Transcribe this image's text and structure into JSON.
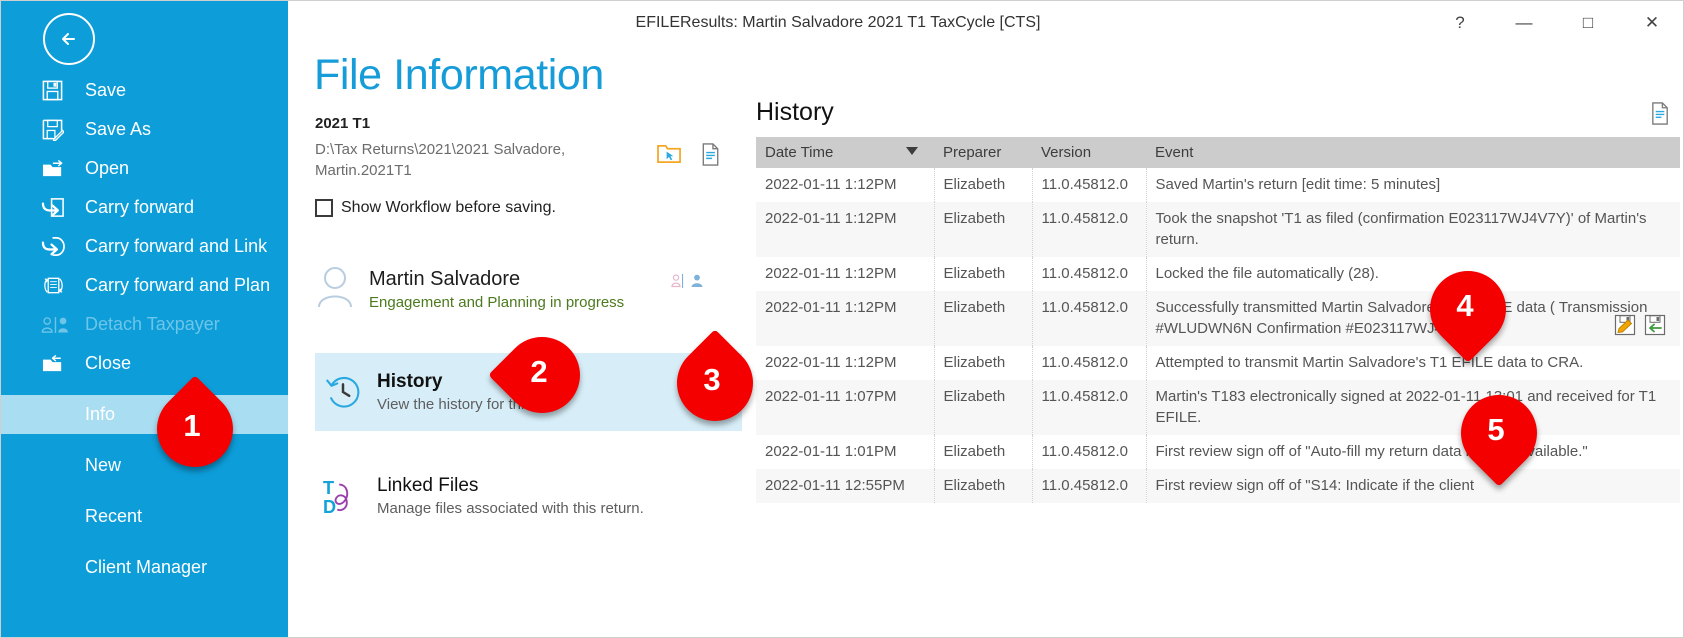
{
  "window": {
    "title": "EFILEResults: Martin Salvadore 2021 T1 TaxCycle [CTS]",
    "help_glyph": "?",
    "minimize_glyph": "—",
    "maximize_glyph": "□",
    "close_glyph": "✕"
  },
  "sidebar": {
    "back_label": "Back",
    "items": [
      {
        "label": "Save",
        "icon": "save-icon",
        "state": "normal"
      },
      {
        "label": "Save As",
        "icon": "save-as-icon",
        "state": "normal"
      },
      {
        "label": "Open",
        "icon": "open-folder-icon",
        "state": "normal"
      },
      {
        "label": "Carry forward",
        "icon": "carry-forward-icon",
        "state": "normal"
      },
      {
        "label": "Carry forward and Link",
        "icon": "carry-forward-link-icon",
        "state": "normal"
      },
      {
        "label": "Carry forward and Plan",
        "icon": "carry-forward-plan-icon",
        "state": "normal"
      },
      {
        "label": "Detach Taxpayer",
        "icon": "detach-taxpayer-icon",
        "state": "disabled"
      },
      {
        "label": "Close",
        "icon": "close-folder-icon",
        "state": "normal"
      },
      {
        "label": "Info",
        "icon": "",
        "state": "selected"
      },
      {
        "label": "New",
        "icon": "",
        "state": "normal"
      },
      {
        "label": "Recent",
        "icon": "",
        "state": "normal"
      },
      {
        "label": "Client Manager",
        "icon": "",
        "state": "normal"
      }
    ]
  },
  "main": {
    "page_title": "File Information",
    "form_year": "2021 T1",
    "file_path": "D:\\Tax Returns\\2021\\2021 Salvadore, Martin.2021T1",
    "path_icons": [
      {
        "name": "open-containing-folder-icon"
      },
      {
        "name": "file-properties-icon"
      }
    ],
    "checkbox": {
      "label": "Show Workflow before saving.",
      "checked": false
    },
    "taxpayer": {
      "name": "Martin Salvadore",
      "status": "Engagement and Planning in progress",
      "avatar_icon": "person-avatar-icon",
      "badges": [
        "couple-link-icon",
        "person-icon"
      ]
    },
    "cards": [
      {
        "title": "History",
        "subtitle": "View the history for this file.",
        "icon": "history-clock-icon",
        "selected": true
      },
      {
        "title": "Linked Files",
        "subtitle": "Manage files associated with this return.",
        "icon": "linked-files-icon",
        "selected": false
      }
    ]
  },
  "history": {
    "heading": "History",
    "export_icon": "export-document-icon",
    "columns": [
      "Date Time",
      "Preparer",
      "Version",
      "Event"
    ],
    "sorted_column": "Date Time",
    "sort_direction": "descending",
    "rows": [
      {
        "datetime": "2022-01-11 1:12PM",
        "preparer": "Elizabeth",
        "version": "11.0.45812.0",
        "event": "Saved Martin's return [edit time: 5 minutes]",
        "actions": []
      },
      {
        "datetime": "2022-01-11 1:12PM",
        "preparer": "Elizabeth",
        "version": "11.0.45812.0",
        "event": "Took the snapshot 'T1 as filed (confirmation E023117WJ4V7Y)' of Martin's return.",
        "actions": []
      },
      {
        "datetime": "2022-01-11 1:12PM",
        "preparer": "Elizabeth",
        "version": "11.0.45812.0",
        "event": "Locked the file automatically (28).",
        "actions": []
      },
      {
        "datetime": "2022-01-11 1:12PM",
        "preparer": "Elizabeth",
        "version": "11.0.45812.0",
        "event": "Successfully transmitted Martin Salvadore's T1 EFILE data  ( Transmission #WLUDWN6N Confirmation #E023117WJ4V7Y ).",
        "actions": [
          "open-snapshot-icon",
          "restore-snapshot-icon"
        ]
      },
      {
        "datetime": "2022-01-11 1:12PM",
        "preparer": "Elizabeth",
        "version": "11.0.45812.0",
        "event": "Attempted to transmit Martin Salvadore's T1 EFILE data to CRA.",
        "actions": []
      },
      {
        "datetime": "2022-01-11 1:07PM",
        "preparer": "Elizabeth",
        "version": "11.0.45812.0",
        "event": "Martin's T183 electronically signed at 2022-01-11 13:01 and received for T1 EFILE.",
        "actions": []
      },
      {
        "datetime": "2022-01-11 1:01PM",
        "preparer": "Elizabeth",
        "version": "11.0.45812.0",
        "event": "First review sign off of \"Auto-fill my return data may be available.\"",
        "actions": []
      },
      {
        "datetime": "2022-01-11 12:55PM",
        "preparer": "Elizabeth",
        "version": "11.0.45812.0",
        "event": "First review sign off of \"S14: Indicate if the client",
        "actions": []
      }
    ]
  },
  "callouts": [
    {
      "number": "1"
    },
    {
      "number": "2"
    },
    {
      "number": "3"
    },
    {
      "number": "4"
    },
    {
      "number": "5"
    }
  ],
  "colors": {
    "accent_blue": "#0d9dd9",
    "title_blue": "#169cd8",
    "selected_card": "#d7eef8",
    "selected_nav": "#a9ddf2",
    "marker_red": "#f40000",
    "status_green": "#4c7a1e"
  }
}
